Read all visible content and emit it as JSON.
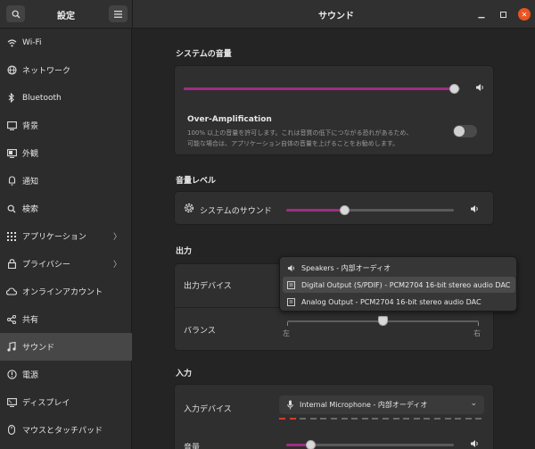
{
  "header": {
    "settings_title": "設定",
    "page_title": "サウンド"
  },
  "sidebar": {
    "items": [
      {
        "label": "Wi-Fi",
        "icon": "wifi-icon"
      },
      {
        "label": "ネットワーク",
        "icon": "network-icon"
      },
      {
        "label": "Bluetooth",
        "icon": "bluetooth-icon"
      },
      {
        "label": "背景",
        "icon": "background-icon"
      },
      {
        "label": "外観",
        "icon": "appearance-icon"
      },
      {
        "label": "通知",
        "icon": "notification-icon"
      },
      {
        "label": "検索",
        "icon": "search-icon"
      },
      {
        "label": "アプリケーション",
        "icon": "apps-icon"
      },
      {
        "label": "プライバシー",
        "icon": "privacy-icon"
      },
      {
        "label": "オンラインアカウント",
        "icon": "cloud-icon"
      },
      {
        "label": "共有",
        "icon": "share-icon"
      },
      {
        "label": "サウンド",
        "icon": "music-icon"
      },
      {
        "label": "電源",
        "icon": "power-icon"
      },
      {
        "label": "ディスプレイ",
        "icon": "display-icon"
      },
      {
        "label": "マウスとタッチパッド",
        "icon": "mouse-icon"
      }
    ],
    "active_index": 11
  },
  "system_volume": {
    "heading": "システムの音量",
    "level": 0.98,
    "over_amp_title": "Over-Amplification",
    "over_amp_desc_1": "100% 以上の音量を許可します。これは音質の低下につながる恐れがあるため、",
    "over_amp_desc_2": "可能な場合は、アプリケーション自体の音量を上げることをお勧めします。",
    "over_amp_enabled": false
  },
  "volume_levels": {
    "heading": "音量レベル",
    "system_sound_label": "システムのサウンド",
    "level": 0.35
  },
  "output": {
    "heading": "出力",
    "device_label": "出力デバイス",
    "balance_label": "バランス",
    "balance_left": "左",
    "balance_right": "右",
    "balance": 0.5,
    "devices": [
      "Speakers - 内部オーディオ",
      "Digital Output (S/PDIF) - PCM2704 16-bit stereo audio DAC",
      "Analog Output - PCM2704 16-bit stereo audio DAC"
    ],
    "highlighted_index": 1
  },
  "input": {
    "heading": "入力",
    "device_label": "入力デバイス",
    "device_value": "Internal Microphone - 内部オーディオ",
    "volume_label": "音量",
    "level": 0.15,
    "level_meter_active": 2
  },
  "colors": {
    "accent": "#a12c82",
    "close": "#e95420",
    "meter_active": "#d63b2f"
  }
}
